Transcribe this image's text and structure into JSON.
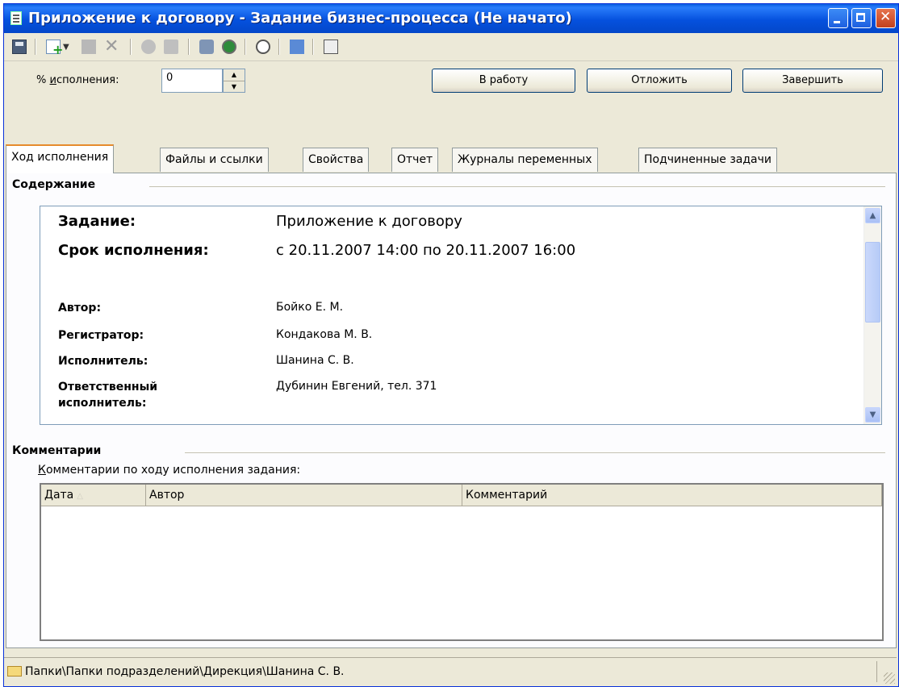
{
  "window": {
    "title": "Приложение к договору - Задание бизнес-процесса (Не начато)"
  },
  "toolbar": {
    "icons": [
      "save-icon",
      "new-icon",
      "dropdown-arrow-icon",
      "document-icon",
      "delete-icon",
      "action-icon",
      "route-icon",
      "print-icon",
      "status-icon",
      "schedule-icon",
      "users-icon",
      "copy-icon"
    ]
  },
  "progress": {
    "label_prefix": "% ",
    "label_underlined": "и",
    "label_rest": "сполнения:",
    "value": "0"
  },
  "buttons": {
    "start": "В работу",
    "postpone": "Отложить",
    "finish": "Завершить"
  },
  "tabs": [
    {
      "label": "Ход исполнения",
      "active": true
    },
    {
      "label": "Файлы и ссылки"
    },
    {
      "label": "Свойства"
    },
    {
      "label": "Отчет"
    },
    {
      "label": "Журналы переменных"
    },
    {
      "label": "Подчиненные задачи"
    }
  ],
  "content": {
    "section_title": "Содержание",
    "task_label": "Задание:",
    "task_value": "Приложение к договору",
    "deadline_label": "Срок исполнения:",
    "deadline_value": "с 20.11.2007 14:00 по 20.11.2007 16:00",
    "author_label": "Автор:",
    "author_value": "Бойко Е. М.",
    "registrar_label": "Регистратор:",
    "registrar_value": "Кондакова М. В.",
    "executor_label": "Исполнитель:",
    "executor_value": "Шанина С. В.",
    "responsible_label_1": "Ответственный",
    "responsible_label_2": "исполнитель:",
    "responsible_value": "Дубинин Евгений, тел. 371"
  },
  "comments": {
    "section_title": "Комментарии",
    "caption_underlined": "К",
    "caption_rest": "омментарии по ходу исполнения задания:",
    "columns": [
      "Дата",
      "Автор",
      "Комментарий"
    ],
    "rows": []
  },
  "status": {
    "path": "Папки\\Папки подразделений\\Дирекция\\Шанина С. В."
  }
}
